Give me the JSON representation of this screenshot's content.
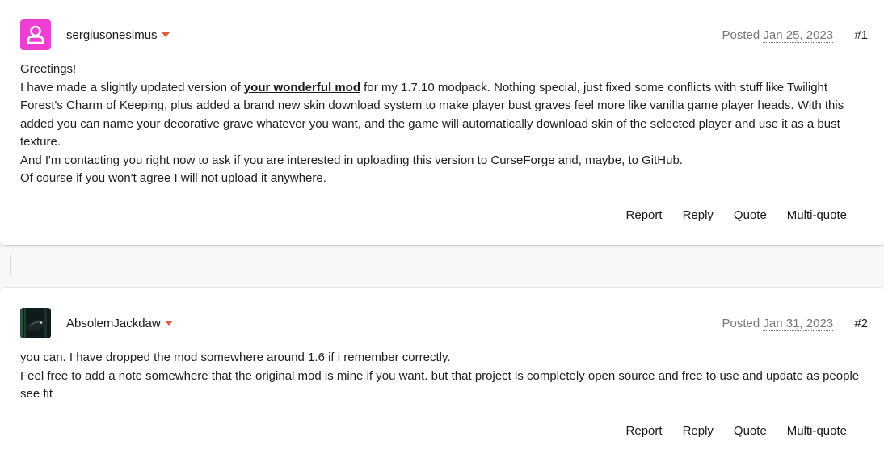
{
  "posts": [
    {
      "username": "sergiusonesimus",
      "avatar": "default-user-icon",
      "posted_label": "Posted",
      "date": "Jan 25, 2023",
      "number": "#1",
      "body": {
        "greeting": "Greetings!",
        "p2_before": "I have made a slightly updated version of ",
        "p2_link": "your wonderful mod",
        "p2_after": " for my 1.7.10 modpack. Nothing special, just fixed some conflicts with stuff like Twilight Forest's Charm of Keeping, plus added a brand new skin download system to make player bust graves feel more like vanilla game player heads. With this added you can name your decorative grave whatever you want, and the game will automatically download skin of the selected player and use it as a bust texture.",
        "p3": "And I'm contacting you right now to ask if you are interested in uploading this version to CurseForge and, maybe, to GitHub.",
        "p4": "Of course if you won't agree I will not upload it anywhere."
      },
      "actions": [
        "Report",
        "Reply",
        "Quote",
        "Multi-quote"
      ]
    },
    {
      "username": "AbsolemJackdaw",
      "avatar": "jackdaw-bird-avatar",
      "posted_label": "Posted",
      "date": "Jan 31, 2023",
      "number": "#2",
      "body": {
        "p1": "you can. I have dropped the mod somewhere around 1.6 if i remember correctly.",
        "p2": "Feel free to add a note somewhere that the original mod is mine if you want. but that project is completely open source and free to use and update as people see fit"
      },
      "actions": [
        "Report",
        "Reply",
        "Quote",
        "Multi-quote"
      ]
    }
  ],
  "colors": {
    "accent": "#e6593d",
    "avatar_pink": "#ee3fd2",
    "background": "#f8f8f9"
  }
}
